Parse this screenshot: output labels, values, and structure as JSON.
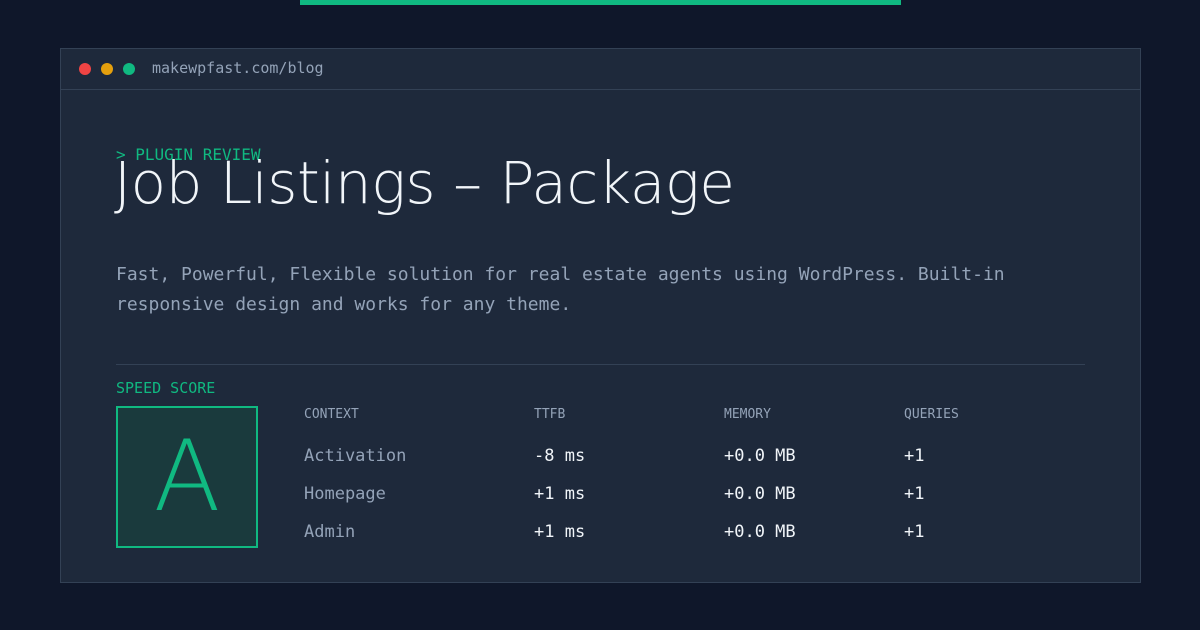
{
  "browser": {
    "url": "makewpfast.com/blog"
  },
  "header": {
    "kicker": "> PLUGIN REVIEW",
    "title": "Job Listings – Package",
    "description": "Fast, Powerful, Flexible solution for real estate agents using WordPress. Built-in responsive design and works for any theme."
  },
  "score": {
    "label": "SPEED SCORE",
    "grade": "A"
  },
  "table": {
    "headers": [
      "CONTEXT",
      "TTFB",
      "MEMORY",
      "QUERIES"
    ],
    "rows": [
      [
        "Activation",
        "-8 ms",
        "+0.0 MB",
        "+1"
      ],
      [
        "Homepage",
        "+1 ms",
        "+0.0 MB",
        "+1"
      ],
      [
        "Admin",
        "+1 ms",
        "+0.0 MB",
        "+1"
      ]
    ]
  },
  "colors": {
    "accent": "#10b981",
    "background": "#0f172a",
    "panel": "#1e293b"
  }
}
